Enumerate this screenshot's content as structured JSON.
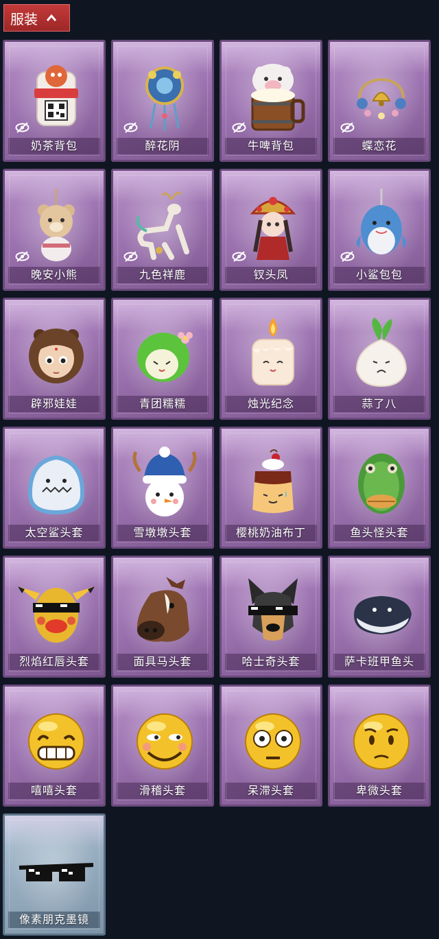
{
  "header": {
    "label": "服装",
    "icon": "chevron-up-icon"
  },
  "items": [
    {
      "label": "奶茶背包",
      "hidden": true,
      "art": "milktea"
    },
    {
      "label": "醉花阴",
      "hidden": true,
      "art": "charm"
    },
    {
      "label": "牛啤背包",
      "hidden": true,
      "art": "cowbeer"
    },
    {
      "label": "蝶恋花",
      "hidden": true,
      "art": "bell"
    },
    {
      "label": "晚安小熊",
      "hidden": true,
      "art": "bear"
    },
    {
      "label": "九色祥鹿",
      "hidden": true,
      "art": "deer"
    },
    {
      "label": "钗头凤",
      "hidden": true,
      "art": "phoenix"
    },
    {
      "label": "小鲨包包",
      "hidden": true,
      "art": "shark"
    },
    {
      "label": "辟邪娃娃",
      "hidden": false,
      "art": "doll"
    },
    {
      "label": "青团糯糯",
      "hidden": false,
      "art": "qingtuan"
    },
    {
      "label": "烛光纪念",
      "hidden": false,
      "art": "candle"
    },
    {
      "label": "蒜了八",
      "hidden": false,
      "art": "garlic"
    },
    {
      "label": "太空鲨头套",
      "hidden": false,
      "art": "spaceshark"
    },
    {
      "label": "雪墩墩头套",
      "hidden": false,
      "art": "snowman"
    },
    {
      "label": "樱桃奶油布丁",
      "hidden": false,
      "art": "pudding"
    },
    {
      "label": "鱼头怪头套",
      "hidden": false,
      "art": "fishhead"
    },
    {
      "label": "烈焰红唇头套",
      "hidden": false,
      "art": "pika"
    },
    {
      "label": "面具马头套",
      "hidden": false,
      "art": "horse"
    },
    {
      "label": "哈士奇头套",
      "hidden": false,
      "art": "husky"
    },
    {
      "label": "萨卡班甲鱼头",
      "hidden": false,
      "art": "fish"
    },
    {
      "label": "嘻嘻头套",
      "hidden": false,
      "art": "grin"
    },
    {
      "label": "滑稽头套",
      "hidden": false,
      "art": "funny"
    },
    {
      "label": "呆滞头套",
      "hidden": false,
      "art": "stare"
    },
    {
      "label": "卑微头套",
      "hidden": false,
      "art": "humble"
    },
    {
      "label": "像素朋克墨镜",
      "hidden": false,
      "art": "glasses",
      "rarity": "blue"
    }
  ]
}
